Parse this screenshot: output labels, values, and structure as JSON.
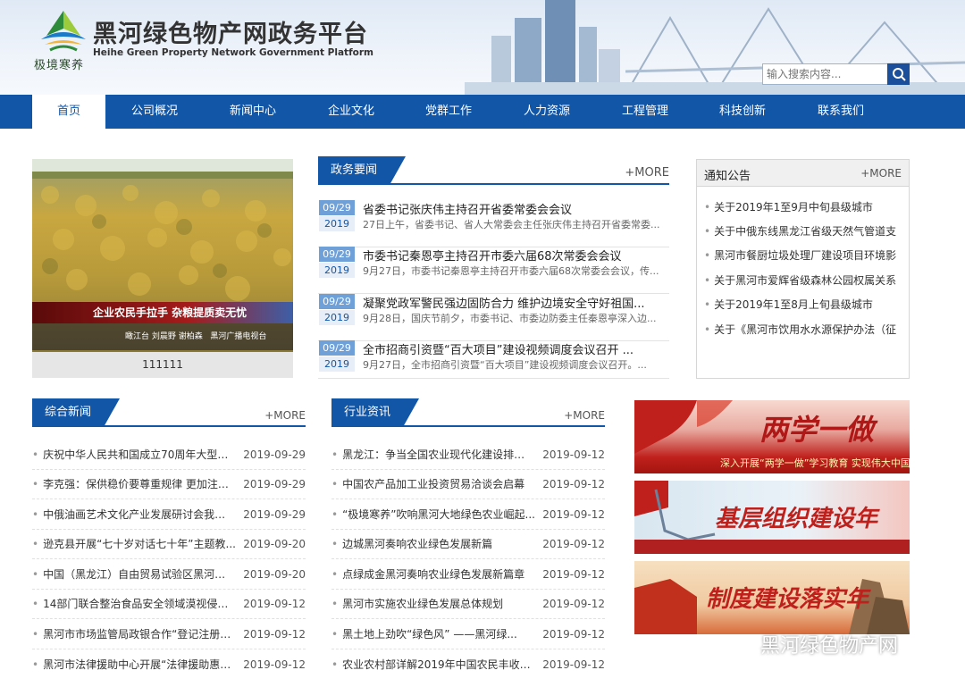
{
  "header": {
    "title": "黑河绿色物产网政务平台",
    "title_en": "Heihe Green Property Network Government Platform",
    "logo_text": "极境寒养",
    "search_placeholder": "输入搜索内容..."
  },
  "nav": {
    "items": [
      {
        "label": "首页",
        "active": true
      },
      {
        "label": "公司概况"
      },
      {
        "label": "新闻中心"
      },
      {
        "label": "企业文化"
      },
      {
        "label": "党群工作"
      },
      {
        "label": "人力资源"
      },
      {
        "label": "工程管理"
      },
      {
        "label": "科技创新"
      },
      {
        "label": "联系我们"
      }
    ]
  },
  "feature": {
    "caption": "111111",
    "banner_text": "企业农民手拉手  杂粮提质卖无忧",
    "sub_text": "瞰江台 刘晨野 谢柏森",
    "watermark_text": "黑河广播电视台"
  },
  "gov_news": {
    "title": "政务要闻",
    "more": "+MORE",
    "items": [
      {
        "md": "09/29",
        "year": "2019",
        "title": "省委书记张庆伟主持召开省委常委会会议",
        "desc": "27日上午，省委书记、省人大常委会主任张庆伟主持召开省委常委..."
      },
      {
        "md": "09/29",
        "year": "2019",
        "title": "市委书记秦恩亭主持召开市委六届68次常委会会议",
        "desc": "9月27日，市委书记秦恩亭主持召开市委六届68次常委会会议，传..."
      },
      {
        "md": "09/29",
        "year": "2019",
        "title": "凝聚党政军警民强边固防合力 维护边境安全守好祖国...",
        "desc": "9月28日，国庆节前夕，市委书记、市委边防委主任秦恩亭深入边..."
      },
      {
        "md": "09/29",
        "year": "2019",
        "title": "全市招商引资暨“百大项目”建设视频调度会议召开 ...",
        "desc": "9月27日，全市招商引资暨“百大项目”建设视频调度会议召开。..."
      }
    ]
  },
  "notice": {
    "title": "通知公告",
    "more": "+MORE",
    "items": [
      "关于2019年1至9月中旬县级城市",
      "关于中俄东线黑龙江省级天然气管道支",
      "黑河市餐厨垃圾处理厂建设项目环境影",
      "关于黑河市爱辉省级森林公园权属关系",
      "关于2019年1至8月上旬县级城市",
      "关于《黑河市饮用水水源保护办法（征"
    ]
  },
  "general_news": {
    "title": "综合新闻",
    "more": "+MORE",
    "items": [
      {
        "title": "庆祝中华人民共和国成立70周年大型成就...",
        "date": "2019-09-29"
      },
      {
        "title": "李克强：保供稳价要尊重规律 更加注重运...",
        "date": "2019-09-29"
      },
      {
        "title": "中俄油画艺术文化产业发展研讨会我市启...",
        "date": "2019-09-29"
      },
      {
        "title": "逊克县开展“七十岁对话七十年”主题教...",
        "date": "2019-09-20"
      },
      {
        "title": "中国（黑龙江）自由贸易试验区黑河片区...",
        "date": "2019-09-20"
      },
      {
        "title": "14部门联合整治食品安全领域漠视侵害群...",
        "date": "2019-09-12"
      },
      {
        "title": "黑河市市场监管局政银合作“登记注册自...",
        "date": "2019-09-12"
      },
      {
        "title": "黑河市法律援助中心开展“法律援助惠民...",
        "date": "2019-09-12"
      }
    ]
  },
  "industry_news": {
    "title": "行业资讯",
    "more": "+MORE",
    "items": [
      {
        "title": "黑龙江：争当全国农业现代化建设排头兵",
        "date": "2019-09-12"
      },
      {
        "title": "中国农产品加工业投资贸易洽谈会启幕",
        "date": "2019-09-12"
      },
      {
        "title": "“极境寒养”吹响黑河大地绿色农业崛起...",
        "date": "2019-09-12"
      },
      {
        "title": "边城黑河奏响农业绿色发展新篇",
        "date": "2019-09-12"
      },
      {
        "title": "点绿成金黑河奏响农业绿色发展新篇章",
        "date": "2019-09-12"
      },
      {
        "title": "黑河市实施农业绿色发展总体规划",
        "date": "2019-09-12"
      },
      {
        "title": "黑土地上劲吹“绿色风”      ——黑河绿...",
        "date": "2019-09-12"
      },
      {
        "title": "农业农村部详解2019年中国农民丰收节活...",
        "date": "2019-09-12"
      }
    ]
  },
  "side_banners": [
    {
      "text": "两学一做",
      "sub": "深入开展“两学一做”学习教育 实现伟大中国梦"
    },
    {
      "text": "基层组织建设年"
    },
    {
      "text": "制度建设落实年"
    }
  ],
  "watermark": {
    "text": "黑河绿色物产网"
  },
  "colors": {
    "primary": "#1256a8",
    "date_badge": "#6fa0d8",
    "banner_red": "#c0201c"
  }
}
